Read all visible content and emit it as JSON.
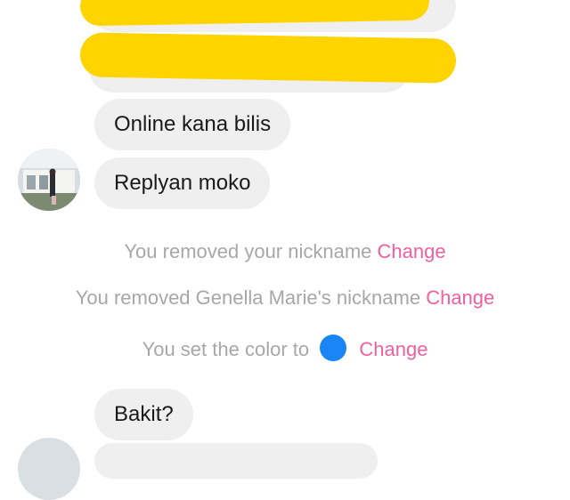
{
  "messages": [
    {
      "text": "Online kana bilis"
    },
    {
      "text": "Replyan moko"
    },
    {
      "text": "Bakit?"
    }
  ],
  "system_events": [
    {
      "text": "You removed your nickname",
      "action": "Change"
    },
    {
      "text": "You removed Genella Marie's nickname",
      "action": "Change"
    },
    {
      "text": "You set the color to",
      "action": "Change",
      "color": "#1a86f5"
    }
  ],
  "colors": {
    "bubble": "#efefef",
    "link": "#f0609f",
    "system_text": "#a7a7a7",
    "redaction": "#ffd400"
  }
}
